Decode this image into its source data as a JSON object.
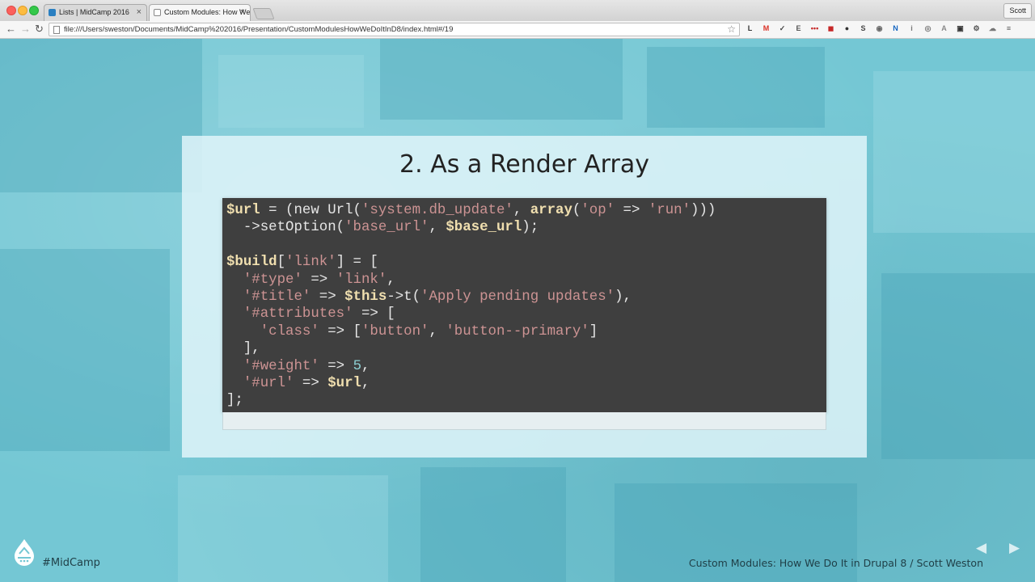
{
  "browser": {
    "tabs": [
      {
        "label": "Lists | MidCamp 2016",
        "active": false
      },
      {
        "label": "Custom Modules: How We",
        "active": true
      }
    ],
    "user_label": "Scott",
    "url": "file:///Users/sweston/Documents/MidCamp%202016/Presentation/CustomModulesHowWeDoItInD8/index.html#/19",
    "extensions": [
      {
        "name": "lastpass-icon",
        "glyph": "L",
        "color": "#333333"
      },
      {
        "name": "gmail-icon",
        "glyph": "M",
        "color": "#d93025"
      },
      {
        "name": "todo-check-icon",
        "glyph": "✓",
        "color": "#444444"
      },
      {
        "name": "evernote-icon",
        "glyph": "E",
        "color": "#555555"
      },
      {
        "name": "dots-icon",
        "glyph": "•••",
        "color": "#c62828"
      },
      {
        "name": "red-square-icon",
        "glyph": "◼",
        "color": "#c62828"
      },
      {
        "name": "record-icon",
        "glyph": "●",
        "color": "#333333"
      },
      {
        "name": "screenshot-icon",
        "glyph": "S",
        "color": "#444444"
      },
      {
        "name": "camera-icon",
        "glyph": "◉",
        "color": "#666666"
      },
      {
        "name": "n-icon",
        "glyph": "N",
        "color": "#1565c0"
      },
      {
        "name": "info-icon",
        "glyph": "i",
        "color": "#777777"
      },
      {
        "name": "globe-icon",
        "glyph": "◎",
        "color": "#777777"
      },
      {
        "name": "angular-icon",
        "glyph": "A",
        "color": "#888888"
      },
      {
        "name": "box-icon",
        "glyph": "▣",
        "color": "#333333"
      },
      {
        "name": "gear-icon",
        "glyph": "⚙",
        "color": "#555555"
      },
      {
        "name": "cloud-icon",
        "glyph": "☁",
        "color": "#777777"
      },
      {
        "name": "menu-icon",
        "glyph": "≡",
        "color": "#555555"
      }
    ]
  },
  "slide": {
    "title": "2. As a Render Array",
    "code_lines": [
      [
        [
          "var",
          "$url"
        ],
        [
          "pl",
          " = (new Url("
        ],
        [
          "str",
          "'system.db_update'"
        ],
        [
          "pl",
          ", "
        ],
        [
          "kw",
          "array"
        ],
        [
          "pl",
          "("
        ],
        [
          "str",
          "'op'"
        ],
        [
          "pl",
          " => "
        ],
        [
          "str",
          "'run'"
        ],
        [
          "pl",
          ")))"
        ]
      ],
      [
        [
          "pl",
          "  ->setOption("
        ],
        [
          "str",
          "'base_url'"
        ],
        [
          "pl",
          ", "
        ],
        [
          "var",
          "$base_url"
        ],
        [
          "pl",
          ");"
        ]
      ],
      [],
      [
        [
          "var",
          "$build"
        ],
        [
          "pl",
          "["
        ],
        [
          "str",
          "'link'"
        ],
        [
          "pl",
          "] = ["
        ]
      ],
      [
        [
          "pl",
          "  "
        ],
        [
          "str",
          "'#type'"
        ],
        [
          "pl",
          " => "
        ],
        [
          "str",
          "'link'"
        ],
        [
          "pl",
          ","
        ]
      ],
      [
        [
          "pl",
          "  "
        ],
        [
          "str",
          "'#title'"
        ],
        [
          "pl",
          " => "
        ],
        [
          "var",
          "$this"
        ],
        [
          "pl",
          "->t("
        ],
        [
          "str",
          "'Apply pending updates'"
        ],
        [
          "pl",
          "),"
        ]
      ],
      [
        [
          "pl",
          "  "
        ],
        [
          "str",
          "'#attributes'"
        ],
        [
          "pl",
          " => ["
        ]
      ],
      [
        [
          "pl",
          "    "
        ],
        [
          "str",
          "'class'"
        ],
        [
          "pl",
          " => ["
        ],
        [
          "str",
          "'button'"
        ],
        [
          "pl",
          ", "
        ],
        [
          "str",
          "'button--primary'"
        ],
        [
          "pl",
          "]"
        ]
      ],
      [
        [
          "pl",
          "  ],"
        ]
      ],
      [
        [
          "pl",
          "  "
        ],
        [
          "str",
          "'#weight'"
        ],
        [
          "pl",
          " => "
        ],
        [
          "num",
          "5"
        ],
        [
          "pl",
          ","
        ]
      ],
      [
        [
          "pl",
          "  "
        ],
        [
          "str",
          "'#url'"
        ],
        [
          "pl",
          " => "
        ],
        [
          "var",
          "$url"
        ],
        [
          "pl",
          ","
        ]
      ],
      [
        [
          "pl",
          "];"
        ]
      ]
    ]
  },
  "footer": {
    "hashtag": "#MidCamp",
    "text": "Custom Modules: How We Do It in Drupal 8  /  Scott Weston",
    "prev_glyph": "◀",
    "next_glyph": "▶"
  }
}
